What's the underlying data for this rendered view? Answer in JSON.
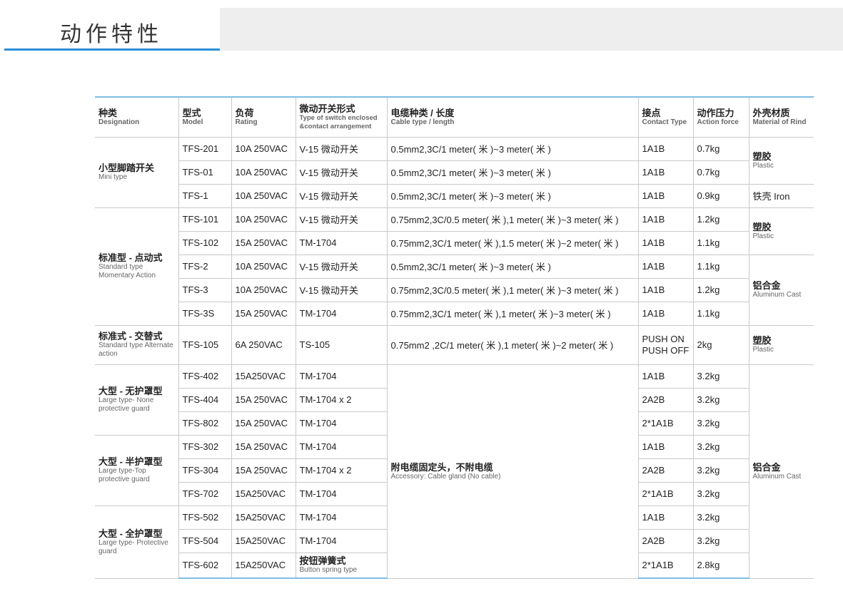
{
  "header": {
    "title": "动作特性"
  },
  "columns": [
    {
      "cn": "种类",
      "en": "Designation"
    },
    {
      "cn": "型式",
      "en": "Model"
    },
    {
      "cn": "负荷",
      "en": "Rating"
    },
    {
      "cn": "微动开关形式",
      "en": "Type of switch enclosed &contact arrangement"
    },
    {
      "cn": "电缆种类 / 长度",
      "en": "Cable type / length"
    },
    {
      "cn": "接点",
      "en": "Contact Type"
    },
    {
      "cn": "动作压力",
      "en": "Action force"
    },
    {
      "cn": "外壳材质",
      "en": "Material of Rind"
    }
  ],
  "groups": [
    {
      "cn": "小型脚踏开关",
      "en": "Mini type"
    },
    {
      "cn": "标准型 - 点动式",
      "en": "Standard type Momentary Action"
    },
    {
      "cn": "标准式 - 交替式",
      "en": "Standard type Alternate action"
    },
    {
      "cn": "大型 - 无护罩型",
      "en": "Large type- None protective guard"
    },
    {
      "cn": "大型 - 半护罩型",
      "en": "Large type-Top protective guard"
    },
    {
      "cn": "大型 - 全护罩型",
      "en": "Large type- Protective guard"
    }
  ],
  "materials": [
    {
      "cn": "塑胶",
      "en": "Plastic"
    },
    {
      "cn": "铁壳 Iron",
      "en": ""
    },
    {
      "cn": "塑胶",
      "en": "Plastic"
    },
    {
      "cn": "铝合金",
      "en": "Aluminum Cast"
    },
    {
      "cn": "塑胶",
      "en": "Plastic"
    },
    {
      "cn": "铝合金",
      "en": "Aluminum Cast"
    }
  ],
  "shared_cable": {
    "cn": "附电缆固定头，不附电缆",
    "en": "Accessory: Cable gland (No cable)"
  },
  "rows": [
    {
      "model": "TFS-201",
      "rating": "10A 250VAC",
      "switch": "V-15 微动开关",
      "cable": "0.5mm2,3C/1 meter( 米 )~3 meter( 米 )",
      "contact": "1A1B",
      "force": "0.7kg"
    },
    {
      "model": "TFS-01",
      "rating": "10A 250VAC",
      "switch": "V-15 微动开关",
      "cable": "0.5mm2,3C/1 meter( 米 )~3 meter( 米 )",
      "contact": "1A1B",
      "force": "0.7kg"
    },
    {
      "model": "TFS-1",
      "rating": "10A 250VAC",
      "switch": "V-15 微动开关",
      "cable": "0.5mm2,3C/1 meter( 米 )~3 meter( 米 )",
      "contact": "1A1B",
      "force": "0.9kg"
    },
    {
      "model": "TFS-101",
      "rating": "10A 250VAC",
      "switch": "V-15 微动开关",
      "cable": "0.75mm2,3C/0.5 meter( 米 ),1 meter( 米 )~3 meter( 米 )",
      "contact": "1A1B",
      "force": "1.2kg"
    },
    {
      "model": "TFS-102",
      "rating": "15A 250VAC",
      "switch": "TM-1704",
      "cable": "0.75mm2,3C/1 meter( 米 ),1.5 meter( 米 )~2 meter( 米 )",
      "contact": "1A1B",
      "force": "1.1kg"
    },
    {
      "model": "TFS-2",
      "rating": "10A 250VAC",
      "switch": "V-15 微动开关",
      "cable": "0.5mm2,3C/1 meter( 米 )~3 meter( 米 )",
      "contact": "1A1B",
      "force": "1.1kg"
    },
    {
      "model": "TFS-3",
      "rating": "10A 250VAC",
      "switch": "V-15 微动开关",
      "cable": "0.75mm2,3C/0.5 meter( 米 ),1 meter( 米 )~3 meter( 米 )",
      "contact": "1A1B",
      "force": "1.2kg"
    },
    {
      "model": "TFS-3S",
      "rating": "15A 250VAC",
      "switch": "TM-1704",
      "cable": "0.75mm2,3C/1 meter( 米 ),1 meter( 米 )~3 meter( 米 )",
      "contact": "1A1B",
      "force": "1.1kg"
    },
    {
      "model": "TFS-105",
      "rating": "6A 250VAC",
      "switch": "TS-105",
      "cable": "0.75mm2 ,2C/1 meter( 米 ),1 meter( 米 )~2 meter( 米 )",
      "contact": "PUSH ON",
      "contact2": "PUSH OFF",
      "force": "2kg"
    },
    {
      "model": "TFS-402",
      "rating": "15A250VAC",
      "switch": "TM-1704",
      "contact": "1A1B",
      "force": "3.2kg"
    },
    {
      "model": "TFS-404",
      "rating": "15A 250VAC",
      "switch": "TM-1704 x 2",
      "contact": "2A2B",
      "force": "3.2kg"
    },
    {
      "model": "TFS-802",
      "rating": "15A 250VAC",
      "switch": "TM-1704",
      "contact": "2*1A1B",
      "force": "3.2kg"
    },
    {
      "model": "TFS-302",
      "rating": "15A 250VAC",
      "switch": "TM-1704",
      "contact": "1A1B",
      "force": "3.2kg"
    },
    {
      "model": "TFS-304",
      "rating": "15A 250VAC",
      "switch": "TM-1704 x 2",
      "contact": "2A2B",
      "force": "3.2kg"
    },
    {
      "model": "TFS-702",
      "rating": "15A250VAC",
      "switch": "TM-1704",
      "contact": "2*1A1B",
      "force": "3.2kg"
    },
    {
      "model": "TFS-502",
      "rating": "15A250VAC",
      "switch": "TM-1704",
      "contact": "1A1B",
      "force": "3.2kg"
    },
    {
      "model": "TFS-504",
      "rating": "15A250VAC",
      "switch": "TM-1704",
      "contact": "2A2B",
      "force": "3.2kg"
    },
    {
      "model": "TFS-602",
      "rating": "15A250VAC",
      "switch": "按钮弹簧式",
      "switch_en": "Button spring type",
      "contact": "2*1A1B",
      "force": "2.8kg"
    }
  ]
}
